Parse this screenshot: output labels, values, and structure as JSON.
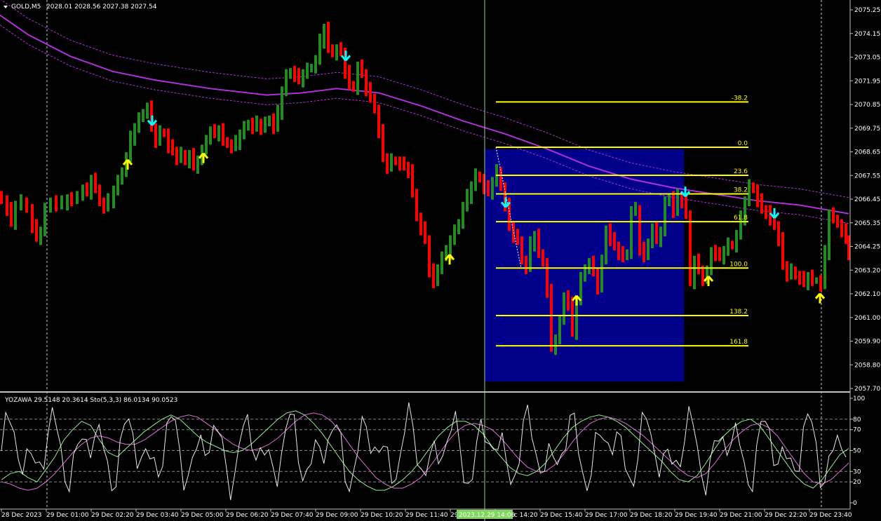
{
  "price_header": {
    "symbol_tf": "GOLD,M5",
    "ohlc": "2028.01 2028.56 2027.38 2027.54"
  },
  "indicator_header": {
    "text": "YOZAWA 29.5148 20.3614  Sto(5,3,3) 86.0134 90.0523"
  },
  "crosshair_time_label": "2023.12.29 14:00",
  "colors": {
    "background": "#000000",
    "bull": "#228b22",
    "bear": "#ff0000",
    "ma": "#b030d8",
    "fib": "#ffff00",
    "fib_rect": "#00008b",
    "buy_arrow": "#ffff00",
    "sell_arrow": "#00ffff",
    "crosshair": "#8fcf8f",
    "grid": "#c0c0c0"
  },
  "chart_data": [
    {
      "type": "bar",
      "title": "GOLD,M5",
      "y_tick_labels": [
        "2075.25",
        "2074.15",
        "2073.05",
        "2071.95",
        "2070.85",
        "2069.75",
        "2068.65",
        "2067.55",
        "2066.45",
        "2065.35",
        "2064.25",
        "2063.20",
        "2062.10",
        "2061.00",
        "2059.90",
        "2058.80",
        "2057.70"
      ],
      "ylim": [
        2057.7,
        2075.25
      ],
      "x_tick_labels": [
        "28 Dec 2023",
        "29 Dec 01:00",
        "29 Dec 02:20",
        "29 Dec 03:40",
        "29 Dec 05:00",
        "29 Dec 06:20",
        "29 Dec 07:40",
        "29 Dec 09:00",
        "29 Dec 10:20",
        "29 Dec 11:40",
        "29 Dec 13:00",
        "29 Dec 14:20",
        "29 Dec 15:40",
        "29 Dec 17:00",
        "29 Dec 18:20",
        "29 Dec 19:40",
        "29 Dec 21:00",
        "29 Dec 22:20",
        "29 Dec 23:40"
      ],
      "candle_close_path": [
        [
          0,
          2066.4
        ],
        [
          8,
          2066.0
        ],
        [
          14,
          2065.4
        ],
        [
          20,
          2066.2
        ],
        [
          28,
          2066.4
        ],
        [
          36,
          2066.0
        ],
        [
          44,
          2065.2
        ],
        [
          50,
          2064.7
        ],
        [
          56,
          2065.0
        ],
        [
          62,
          2066.0
        ],
        [
          70,
          2066.4
        ],
        [
          78,
          2066.2
        ],
        [
          86,
          2066.3
        ],
        [
          94,
          2066.5
        ],
        [
          100,
          2066.4
        ],
        [
          108,
          2066.7
        ],
        [
          116,
          2066.9
        ],
        [
          122,
          2066.8
        ],
        [
          128,
          2067.4
        ],
        [
          134,
          2067.0
        ],
        [
          140,
          2066.3
        ],
        [
          146,
          2066.1
        ],
        [
          152,
          2066.4
        ],
        [
          160,
          2066.9
        ],
        [
          166,
          2067.3
        ],
        [
          172,
          2067.8
        ],
        [
          178,
          2068.4
        ],
        [
          184,
          2069.3
        ],
        [
          190,
          2069.8
        ],
        [
          196,
          2070.2
        ],
        [
          202,
          2070.5
        ],
        [
          208,
          2070.7
        ],
        [
          214,
          2069.8
        ],
        [
          220,
          2069.2
        ],
        [
          226,
          2069.6
        ],
        [
          232,
          2069.5
        ],
        [
          238,
          2068.9
        ],
        [
          244,
          2068.7
        ],
        [
          250,
          2068.4
        ],
        [
          256,
          2068.6
        ],
        [
          262,
          2068.2
        ],
        [
          268,
          2068.5
        ],
        [
          274,
          2068.0
        ],
        [
          280,
          2068.3
        ],
        [
          286,
          2068.7
        ],
        [
          292,
          2069.3
        ],
        [
          298,
          2069.6
        ],
        [
          304,
          2069.5
        ],
        [
          310,
          2069.7
        ],
        [
          316,
          2069.2
        ],
        [
          322,
          2069.0
        ],
        [
          328,
          2068.9
        ],
        [
          334,
          2069.1
        ],
        [
          340,
          2069.5
        ],
        [
          346,
          2069.8
        ],
        [
          352,
          2070.0
        ],
        [
          358,
          2069.8
        ],
        [
          364,
          2070.0
        ],
        [
          370,
          2069.8
        ],
        [
          376,
          2070.0
        ],
        [
          382,
          2070.2
        ],
        [
          388,
          2069.8
        ],
        [
          394,
          2070.5
        ],
        [
          400,
          2071.5
        ],
        [
          406,
          2072.2
        ],
        [
          412,
          2072.4
        ],
        [
          418,
          2072.2
        ],
        [
          424,
          2072.0
        ],
        [
          430,
          2072.3
        ],
        [
          436,
          2072.5
        ],
        [
          442,
          2072.6
        ],
        [
          448,
          2072.9
        ],
        [
          454,
          2073.8
        ],
        [
          460,
          2074.4
        ],
        [
          466,
          2073.5
        ],
        [
          472,
          2073.2
        ],
        [
          478,
          2073.4
        ],
        [
          484,
          2073.3
        ],
        [
          490,
          2072.4
        ],
        [
          496,
          2071.8
        ],
        [
          502,
          2071.6
        ],
        [
          508,
          2072.6
        ],
        [
          514,
          2072.3
        ],
        [
          520,
          2071.6
        ],
        [
          526,
          2071.2
        ],
        [
          532,
          2070.6
        ],
        [
          538,
          2069.6
        ],
        [
          544,
          2068.4
        ],
        [
          550,
          2068.0
        ],
        [
          556,
          2068.3
        ],
        [
          562,
          2068.2
        ],
        [
          568,
          2068.1
        ],
        [
          574,
          2068.0
        ],
        [
          580,
          2067.8
        ],
        [
          586,
          2066.8
        ],
        [
          592,
          2065.6
        ],
        [
          598,
          2065.1
        ],
        [
          604,
          2064.6
        ],
        [
          610,
          2063.2
        ],
        [
          616,
          2062.6
        ],
        [
          622,
          2063.3
        ],
        [
          628,
          2063.8
        ],
        [
          634,
          2064.0
        ],
        [
          640,
          2064.6
        ],
        [
          646,
          2065.0
        ],
        [
          652,
          2065.4
        ],
        [
          658,
          2066.1
        ],
        [
          664,
          2066.6
        ],
        [
          670,
          2067.1
        ],
        [
          676,
          2067.6
        ],
        [
          682,
          2067.4
        ],
        [
          688,
          2067.0
        ],
        [
          694,
          2066.8
        ],
        [
          700,
          2067.3
        ],
        [
          706,
          2067.8
        ],
        [
          712,
          2067.0
        ],
        [
          718,
          2066.2
        ],
        [
          724,
          2065.2
        ],
        [
          730,
          2064.8
        ],
        [
          736,
          2064.6
        ],
        [
          742,
          2063.6
        ],
        [
          748,
          2063.3
        ],
        [
          754,
          2064.4
        ],
        [
          760,
          2064.8
        ],
        [
          766,
          2064.0
        ],
        [
          772,
          2063.5
        ],
        [
          778,
          2062.2
        ],
        [
          784,
          2059.6
        ],
        [
          790,
          2060.0
        ],
        [
          796,
          2060.8
        ],
        [
          802,
          2062.0
        ],
        [
          808,
          2061.6
        ],
        [
          814,
          2060.3
        ],
        [
          820,
          2061.8
        ],
        [
          826,
          2062.8
        ],
        [
          832,
          2063.3
        ],
        [
          838,
          2063.5
        ],
        [
          844,
          2063.1
        ],
        [
          850,
          2062.4
        ],
        [
          856,
          2063.6
        ],
        [
          862,
          2065.1
        ],
        [
          868,
          2064.6
        ],
        [
          874,
          2064.3
        ],
        [
          880,
          2064.0
        ],
        [
          886,
          2063.8
        ],
        [
          892,
          2064.0
        ],
        [
          898,
          2065.9
        ],
        [
          904,
          2066.0
        ],
        [
          910,
          2064.2
        ],
        [
          916,
          2063.8
        ],
        [
          922,
          2064.5
        ],
        [
          928,
          2065.1
        ],
        [
          934,
          2064.6
        ],
        [
          940,
          2065.0
        ],
        [
          946,
          2066.3
        ],
        [
          952,
          2066.6
        ],
        [
          958,
          2065.9
        ],
        [
          964,
          2066.6
        ],
        [
          970,
          2066.4
        ],
        [
          976,
          2065.8
        ],
        [
          982,
          2062.6
        ],
        [
          988,
          2063.6
        ],
        [
          994,
          2063.2
        ],
        [
          1000,
          2062.8
        ],
        [
          1006,
          2063.1
        ],
        [
          1012,
          2064.1
        ],
        [
          1018,
          2063.9
        ],
        [
          1024,
          2063.8
        ],
        [
          1030,
          2064.1
        ],
        [
          1036,
          2064.4
        ],
        [
          1042,
          2064.3
        ],
        [
          1048,
          2064.8
        ],
        [
          1054,
          2065.6
        ],
        [
          1060,
          2066.4
        ],
        [
          1066,
          2067.1
        ],
        [
          1072,
          2066.9
        ],
        [
          1078,
          2066.4
        ],
        [
          1084,
          2066.0
        ],
        [
          1090,
          2065.9
        ],
        [
          1096,
          2065.5
        ],
        [
          1102,
          2065.2
        ],
        [
          1108,
          2064.6
        ],
        [
          1114,
          2063.4
        ],
        [
          1120,
          2063.0
        ],
        [
          1126,
          2063.2
        ],
        [
          1132,
          2062.9
        ],
        [
          1138,
          2062.8
        ],
        [
          1144,
          2062.6
        ],
        [
          1150,
          2062.9
        ],
        [
          1156,
          2062.7
        ],
        [
          1162,
          2062.7
        ],
        [
          1168,
          2062.5
        ],
        [
          1174,
          2064.0
        ],
        [
          1180,
          2065.8
        ],
        [
          1186,
          2065.6
        ],
        [
          1192,
          2065.3
        ],
        [
          1198,
          2065.0
        ],
        [
          1204,
          2064.6
        ],
        [
          1208,
          2064.0
        ]
      ],
      "moving_average": [
        [
          0,
          2075.0
        ],
        [
          40,
          2074.1
        ],
        [
          100,
          2073.1
        ],
        [
          160,
          2072.4
        ],
        [
          220,
          2072.0
        ],
        [
          300,
          2071.6
        ],
        [
          380,
          2071.3
        ],
        [
          430,
          2071.4
        ],
        [
          480,
          2071.6
        ],
        [
          540,
          2071.4
        ],
        [
          600,
          2070.8
        ],
        [
          660,
          2070.1
        ],
        [
          720,
          2069.5
        ],
        [
          780,
          2068.8
        ],
        [
          840,
          2068.0
        ],
        [
          900,
          2067.4
        ],
        [
          960,
          2067.0
        ],
        [
          1020,
          2066.7
        ],
        [
          1080,
          2066.4
        ],
        [
          1140,
          2066.2
        ],
        [
          1210,
          2065.8
        ]
      ],
      "fibonacci": {
        "levels": [
          {
            "label": "-38.2",
            "price": 2070.98
          },
          {
            "label": "0.0",
            "price": 2068.88
          },
          {
            "label": "23.6",
            "price": 2067.58
          },
          {
            "label": "38.2",
            "price": 2066.72
          },
          {
            "label": "61.8",
            "price": 2065.43
          },
          {
            "label": "100.0",
            "price": 2063.28
          },
          {
            "label": "138.2",
            "price": 2061.08
          },
          {
            "label": "161.8",
            "price": 2059.68
          }
        ]
      },
      "buy_arrows": [
        [
          182,
          2068.3
        ],
        [
          290,
          2068.6
        ],
        [
          641,
          2063.9
        ],
        [
          822,
          2062.0
        ],
        [
          1010,
          2062.9
        ],
        [
          1169,
          2062.1
        ]
      ],
      "sell_arrows": [
        [
          217,
          2069.9
        ],
        [
          493,
          2072.9
        ],
        [
          721,
          2066.1
        ],
        [
          977,
          2066.6
        ],
        [
          1104,
          2065.6
        ]
      ]
    },
    {
      "type": "line",
      "title": "YOZAWA 29.5148 20.3614  Sto(5,3,3) 86.0134 90.0523",
      "y_tick_labels": [
        "100",
        "80",
        "70",
        "50",
        "30",
        "20",
        "0"
      ],
      "levels": [
        80,
        70,
        50,
        30,
        20
      ],
      "ylim": [
        0,
        100
      ],
      "series": [
        {
          "name": "Sto(5,3,3) main",
          "values": [
            22,
            28,
            30,
            24,
            20,
            32,
            44,
            60,
            70,
            78,
            74,
            60,
            48,
            44,
            52,
            60,
            68,
            74,
            80,
            84,
            80,
            72,
            64,
            58,
            54,
            50,
            48,
            50,
            56,
            64,
            72,
            80,
            86,
            88,
            84,
            76,
            66,
            54,
            42,
            30,
            22,
            16,
            12,
            12,
            16,
            22,
            30,
            40,
            52,
            64,
            72,
            78,
            78,
            74,
            66,
            54,
            44,
            34,
            28,
            26,
            30,
            38,
            50,
            62,
            72,
            78,
            82,
            84,
            82,
            78,
            72,
            64,
            56,
            48,
            40,
            30,
            22,
            20,
            26,
            38,
            52,
            64,
            72,
            78,
            80,
            74,
            62,
            50,
            38,
            26,
            18,
            14,
            22,
            34,
            46,
            52
          ]
        },
        {
          "name": "Sto(5,3,3) signal",
          "values": [
            20,
            18,
            14,
            12,
            14,
            20,
            28,
            38,
            48,
            56,
            62,
            64,
            62,
            58,
            56,
            56,
            60,
            66,
            72,
            78,
            82,
            84,
            82,
            76,
            70,
            62,
            56,
            52,
            50,
            52,
            56,
            62,
            70,
            78,
            84,
            86,
            84,
            78,
            68,
            56,
            44,
            34,
            24,
            18,
            14,
            14,
            18,
            24,
            34,
            46,
            58,
            68,
            74,
            76,
            74,
            70,
            62,
            52,
            42,
            34,
            30,
            30,
            36,
            46,
            58,
            68,
            76,
            80,
            82,
            80,
            76,
            70,
            64,
            56,
            48,
            40,
            32,
            26,
            24,
            28,
            38,
            50,
            60,
            68,
            74,
            76,
            72,
            64,
            52,
            40,
            28,
            20,
            18,
            22,
            30,
            38
          ]
        }
      ]
    }
  ]
}
